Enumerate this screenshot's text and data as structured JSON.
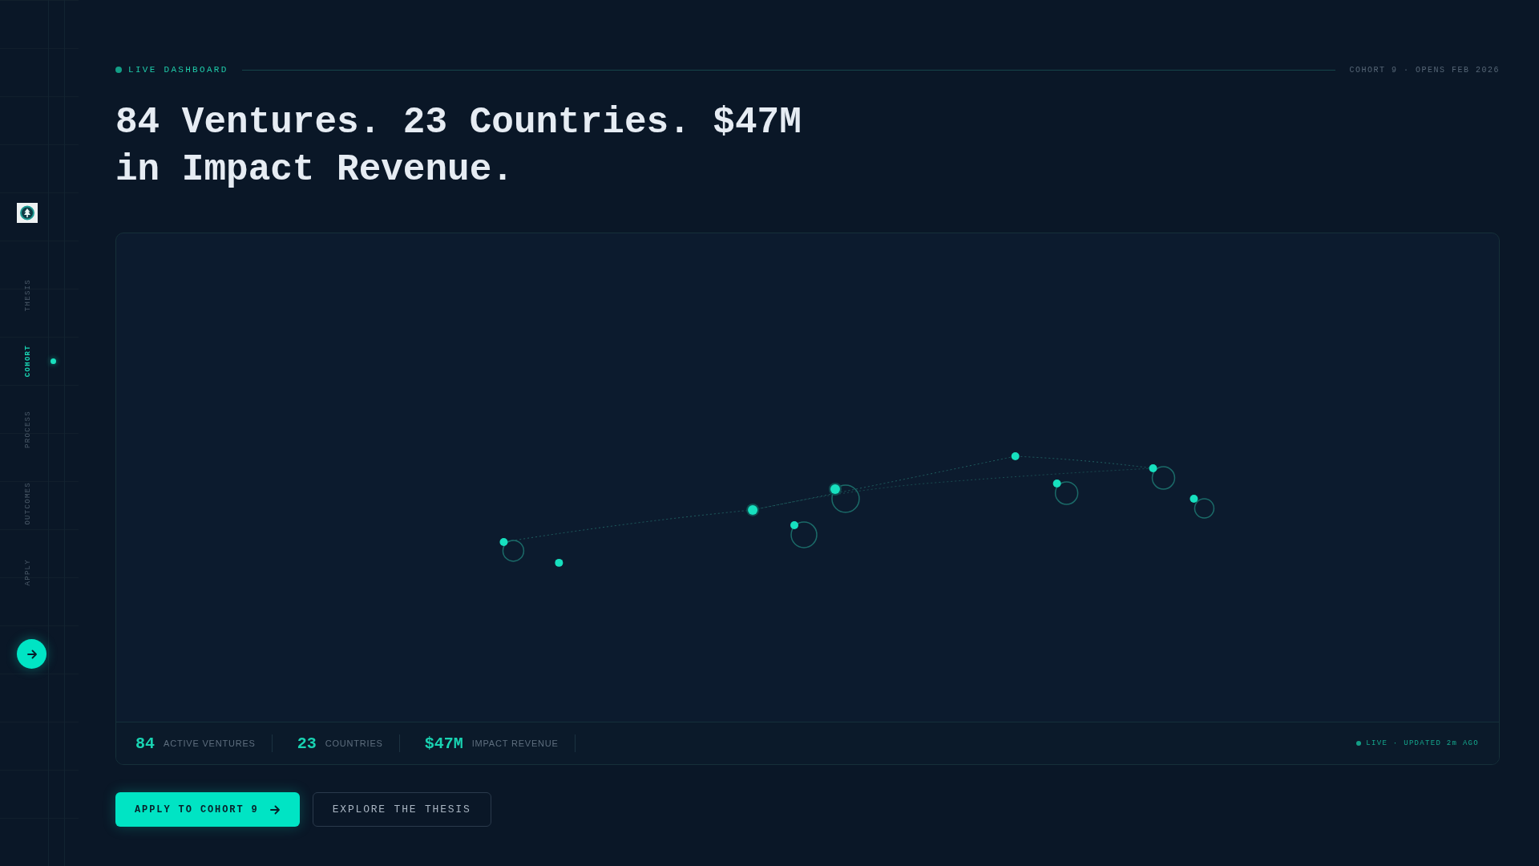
{
  "sidebar": {
    "nav_items": [
      {
        "label": "THESIS",
        "selected": false
      },
      {
        "label": "COHORT",
        "selected": true
      },
      {
        "label": "PROCESS",
        "selected": false
      },
      {
        "label": "OUTCOMES",
        "selected": false
      },
      {
        "label": "APPLY",
        "selected": false
      }
    ]
  },
  "header": {
    "badge": "LIVE DASHBOARD",
    "cohort_note": "COHORT 9 · OPENS FEB 2026"
  },
  "headline": "84 Ventures. 23 Countries. $47M in Impact Revenue.",
  "map": {
    "markers": [
      {
        "pulse": true
      },
      {
        "pulse": false
      },
      {
        "pulse": false
      },
      {
        "pulse": true
      },
      {
        "pulse": true
      },
      {
        "pulse": false
      },
      {
        "pulse": true
      },
      {
        "pulse": true
      },
      {
        "pulse": true
      }
    ]
  },
  "stats": [
    {
      "value": "84",
      "label": "ACTIVE VENTURES"
    },
    {
      "value": "23",
      "label": "COUNTRIES"
    },
    {
      "value": "$47M",
      "label": "IMPACT REVENUE"
    }
  ],
  "live_status": "LIVE · UPDATED 2m AGO",
  "buttons": [
    {
      "label": "APPLY TO COHORT 9",
      "kind": "primary"
    },
    {
      "label": "EXPLORE THE THESIS",
      "kind": "secondary"
    }
  ]
}
